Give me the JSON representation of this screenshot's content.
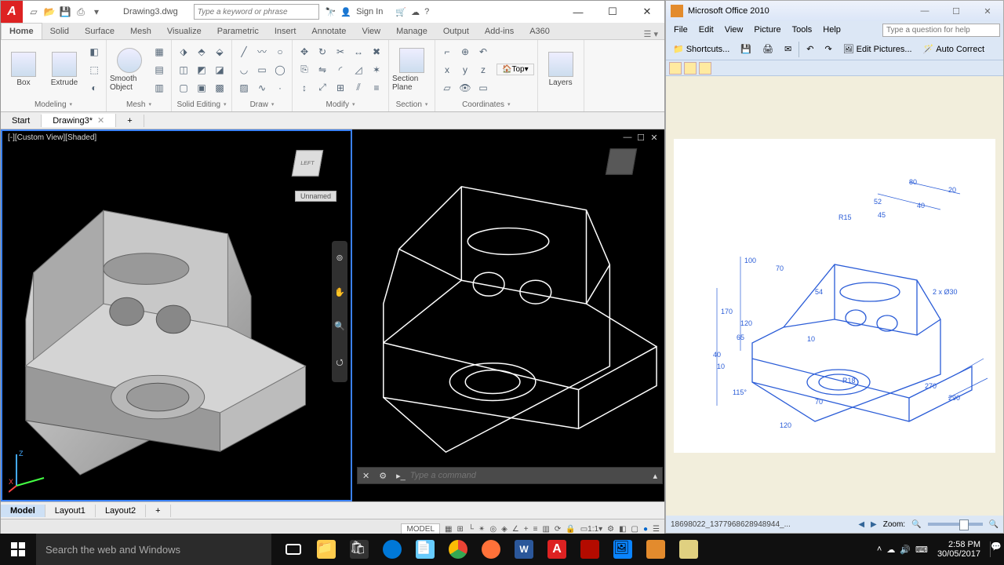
{
  "acad": {
    "doc_title": "Drawing3.dwg",
    "search_placeholder": "Type a keyword or phrase",
    "signin": "Sign In",
    "tabs": [
      "Home",
      "Solid",
      "Surface",
      "Mesh",
      "Visualize",
      "Parametric",
      "Insert",
      "Annotate",
      "View",
      "Manage",
      "Output",
      "Add-ins",
      "A360"
    ],
    "active_tab": "Home",
    "panels": {
      "modeling": "Modeling",
      "mesh": "Mesh",
      "solidedit": "Solid Editing",
      "draw": "Draw",
      "modify": "Modify",
      "section": "Section",
      "coords": "Coordinates",
      "box": "Box",
      "extrude": "Extrude",
      "smooth": "Smooth Object",
      "sectionplane": "Section Plane",
      "layers": "Layers",
      "top": "Top"
    },
    "doctabs": {
      "start": "Start",
      "drawing": "Drawing3*"
    },
    "viewport_label": "[-][Custom View][Shaded]",
    "unnamed": "Unnamed",
    "cmd_placeholder": "Type a command",
    "layouts": [
      "Model",
      "Layout1",
      "Layout2"
    ],
    "status_model": "MODEL",
    "status_scale": "1:1"
  },
  "mso": {
    "title": "Microsoft Office 2010",
    "menus": [
      "File",
      "Edit",
      "View",
      "Picture",
      "Tools",
      "Help"
    ],
    "ask": "Type a question for help",
    "shortcuts": "Shortcuts...",
    "editpics": "Edit Pictures...",
    "autocorrect": "Auto Correct",
    "filename": "18698022_1377968628948944_...",
    "zoom": "Zoom:",
    "drawing_dims": {
      "d80": "80",
      "d20": "20",
      "d52": "52",
      "d40": "40",
      "d45": "45",
      "r15": "R15",
      "d100": "100",
      "d70v": "70",
      "d170": "170",
      "d120l": "120",
      "d65": "65",
      "d40l": "40",
      "d10l": "10",
      "d115": "115°",
      "d120b": "120",
      "d10": "10",
      "d70": "70",
      "r18": "R18",
      "d54": "54",
      "hole": "2 x Ø30",
      "d270": "270",
      "d290": "290"
    }
  },
  "taskbar": {
    "search": "Search the web and Windows",
    "time": "2:58 PM",
    "date": "30/05/2017"
  }
}
